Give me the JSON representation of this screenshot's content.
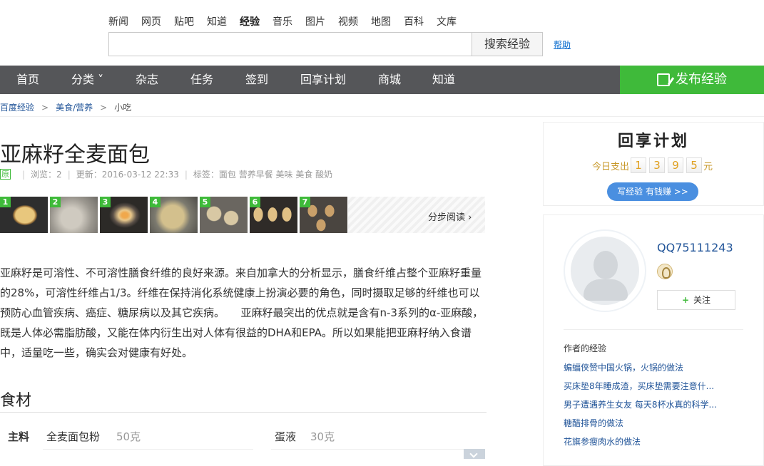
{
  "topnav": [
    "新闻",
    "网页",
    "贴吧",
    "知道",
    "经验",
    "音乐",
    "图片",
    "视频",
    "地图",
    "百科",
    "文库"
  ],
  "search": {
    "button": "搜索经验",
    "help": "帮助",
    "value": ""
  },
  "navbar": {
    "items": [
      "首页",
      "分类 ˅",
      "杂志",
      "任务",
      "签到",
      "回享计划",
      "商城",
      "知道"
    ],
    "publish": "发布经验"
  },
  "breadcrumb": [
    "百度经验",
    "美食/营养",
    "小吃"
  ],
  "article": {
    "title": "亚麻籽全麦面包",
    "original": "原",
    "views": "浏览：2",
    "updated": "更新：2016-03-12 22:33",
    "tags": "标签：面包 营养早餐 美味 美食 酸奶",
    "steps": [
      "1",
      "2",
      "3",
      "4",
      "5",
      "6",
      "7"
    ],
    "step_read": "分步阅读 ›",
    "paragraph": "亚麻籽是可溶性、不可溶性膳食纤维的良好来源。来自加拿大的分析显示，膳食纤维占整个亚麻籽重量的28%，可溶性纤维占1/3。纤维在保持消化系统健康上扮演必要的角色，同时摄取足够的纤维也可以预防心血管疾病、癌症、糖尿病以及其它疾病。　　亚麻籽最突出的优点就是含有n-3系列的α-亚麻酸，既是人体必需脂肪酸，又能在体内衍生出对人体有很益的DHA和EPA。所以如果能把亚麻籽纳入食谱中，适量吃一些，确实会对健康有好处。"
  },
  "ingredients": {
    "heading": "食材",
    "label": "主料",
    "items": [
      {
        "name": "全麦面包粉",
        "amount": "50克"
      },
      {
        "name": "蛋液",
        "amount": "30克"
      }
    ]
  },
  "plan": {
    "title": "回享计划",
    "label": "今日支出",
    "digits": [
      "1",
      "3",
      "9",
      "5"
    ],
    "unit": "元",
    "button": "写经验 有钱赚 >>"
  },
  "author": {
    "name": "QQ75111243",
    "follow": "关注",
    "heading": "作者的经验",
    "experiences": [
      "蝙蝠侠赞中国火锅，火锅的做法",
      "买床垫8年睡成渣，买床垫需要注意什...",
      "男子遭遇养生女友 每天8杯水真的科学...",
      "糖醋排骨的做法",
      "花旗参瘦肉水的做法"
    ]
  }
}
